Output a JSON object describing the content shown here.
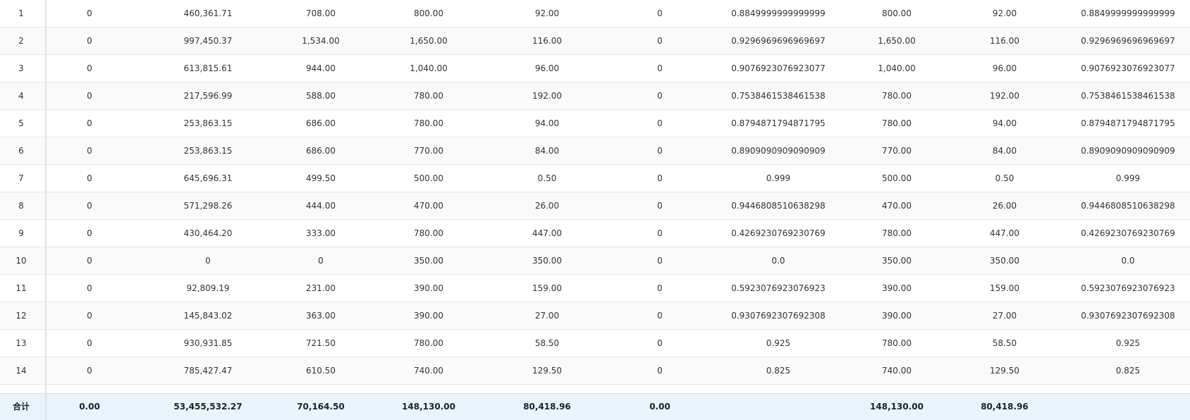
{
  "table": {
    "rows": [
      [
        "1",
        "0",
        "460,361.71",
        "708.00",
        "800.00",
        "92.00",
        "0",
        "0.8849999999999999",
        "800.00",
        "92.00",
        "0.8849999999999999"
      ],
      [
        "2",
        "0",
        "997,450.37",
        "1,534.00",
        "1,650.00",
        "116.00",
        "0",
        "0.9296969696969697",
        "1,650.00",
        "116.00",
        "0.9296969696969697"
      ],
      [
        "3",
        "0",
        "613,815.61",
        "944.00",
        "1,040.00",
        "96.00",
        "0",
        "0.9076923076923077",
        "1,040.00",
        "96.00",
        "0.9076923076923077"
      ],
      [
        "4",
        "0",
        "217,596.99",
        "588.00",
        "780.00",
        "192.00",
        "0",
        "0.7538461538461538",
        "780.00",
        "192.00",
        "0.7538461538461538"
      ],
      [
        "5",
        "0",
        "253,863.15",
        "686.00",
        "780.00",
        "94.00",
        "0",
        "0.8794871794871795",
        "780.00",
        "94.00",
        "0.8794871794871795"
      ],
      [
        "6",
        "0",
        "253,863.15",
        "686.00",
        "770.00",
        "84.00",
        "0",
        "0.8909090909090909",
        "770.00",
        "84.00",
        "0.8909090909090909"
      ],
      [
        "7",
        "0",
        "645,696.31",
        "499.50",
        "500.00",
        "0.50",
        "0",
        "0.999",
        "500.00",
        "0.50",
        "0.999"
      ],
      [
        "8",
        "0",
        "571,298.26",
        "444.00",
        "470.00",
        "26.00",
        "0",
        "0.9446808510638298",
        "470.00",
        "26.00",
        "0.9446808510638298"
      ],
      [
        "9",
        "0",
        "430,464.20",
        "333.00",
        "780.00",
        "447.00",
        "0",
        "0.4269230769230769",
        "780.00",
        "447.00",
        "0.4269230769230769"
      ],
      [
        "10",
        "0",
        "0",
        "0",
        "350.00",
        "350.00",
        "0",
        "0.0",
        "350.00",
        "350.00",
        "0.0"
      ],
      [
        "11",
        "0",
        "92,809.19",
        "231.00",
        "390.00",
        "159.00",
        "0",
        "0.5923076923076923",
        "390.00",
        "159.00",
        "0.5923076923076923"
      ],
      [
        "12",
        "0",
        "145,843.02",
        "363.00",
        "390.00",
        "27.00",
        "0",
        "0.9307692307692308",
        "390.00",
        "27.00",
        "0.9307692307692308"
      ],
      [
        "13",
        "0",
        "930,931.85",
        "721.50",
        "780.00",
        "58.50",
        "0",
        "0.925",
        "780.00",
        "58.50",
        "0.925"
      ],
      [
        "14",
        "0",
        "785,427.47",
        "610.50",
        "740.00",
        "129.50",
        "0",
        "0.825",
        "740.00",
        "129.50",
        "0.825"
      ]
    ],
    "summary": [
      "合计",
      "0.00",
      "53,455,532.27",
      "70,164.50",
      "148,130.00",
      "80,418.96",
      "0.00",
      "",
      "148,130.00",
      "80,418.96",
      ""
    ]
  }
}
